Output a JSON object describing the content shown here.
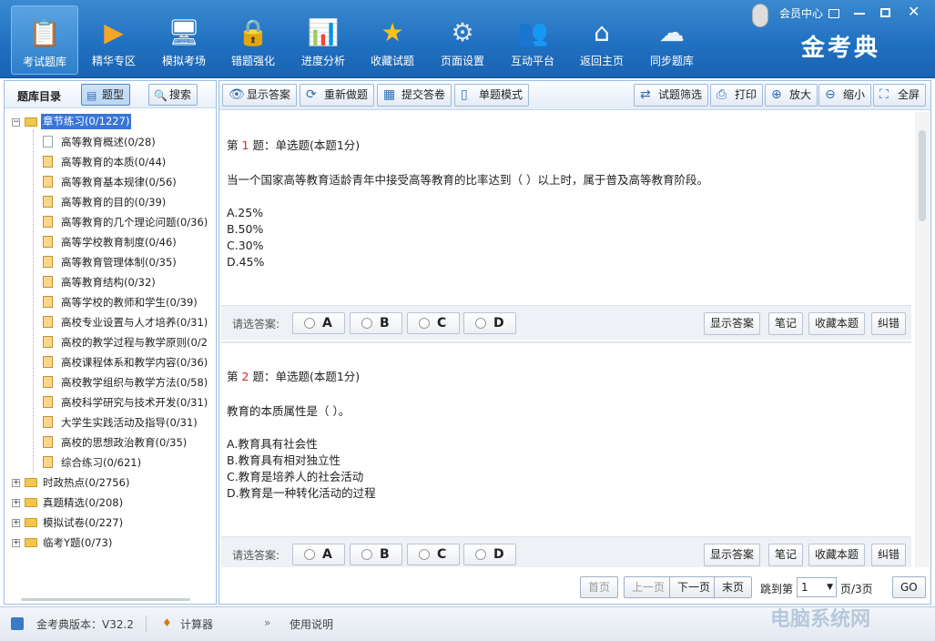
{
  "app": {
    "title": "金考典"
  },
  "toolbar_top": [
    {
      "label": "考试题库",
      "icon": "document-stack-icon",
      "glyph": "📋"
    },
    {
      "label": "精华专区",
      "icon": "play-disc-icon",
      "glyph": "▶"
    },
    {
      "label": "模拟考场",
      "icon": "monitor-icon",
      "glyph": "🖥"
    },
    {
      "label": "错题强化",
      "icon": "clipboard-lock-icon",
      "glyph": "🔒"
    },
    {
      "label": "进度分析",
      "icon": "bar-chart-icon",
      "glyph": "📊"
    },
    {
      "label": "收藏试题",
      "icon": "star-icon",
      "glyph": "★"
    },
    {
      "label": "页面设置",
      "icon": "gear-icon",
      "glyph": "⚙"
    },
    {
      "label": "互动平台",
      "icon": "users-icon",
      "glyph": "👥"
    },
    {
      "label": "返回主页",
      "icon": "home-icon",
      "glyph": "⌂"
    },
    {
      "label": "同步题库",
      "icon": "cloud-sync-icon",
      "glyph": "☁"
    }
  ],
  "window": {
    "member": "会员中心"
  },
  "left": {
    "title": "题库目录",
    "btn_type": "题型",
    "btn_search": "搜索",
    "tree_root": "章节练习(0/1227)",
    "chapters": [
      {
        "label": "高等教育概述(0/28)",
        "kind": "page"
      },
      {
        "label": "高等教育的本质(0/44)",
        "kind": "lock"
      },
      {
        "label": "高等教育基本规律(0/56)",
        "kind": "lock"
      },
      {
        "label": "高等教育的目的(0/39)",
        "kind": "lock"
      },
      {
        "label": "高等教育的几个理论问题(0/36)",
        "kind": "lock"
      },
      {
        "label": "高等学校教育制度(0/46)",
        "kind": "lock"
      },
      {
        "label": "高等教育管理体制(0/35)",
        "kind": "lock"
      },
      {
        "label": "高等教育结构(0/32)",
        "kind": "lock"
      },
      {
        "label": "高等学校的教师和学生(0/39)",
        "kind": "lock"
      },
      {
        "label": "高校专业设置与人才培养(0/31)",
        "kind": "lock"
      },
      {
        "label": "高校的教学过程与教学原则(0/2",
        "kind": "lock"
      },
      {
        "label": "高校课程体系和教学内容(0/36)",
        "kind": "lock"
      },
      {
        "label": "高校教学组织与教学方法(0/58)",
        "kind": "lock"
      },
      {
        "label": "高校科学研究与技术开发(0/31)",
        "kind": "lock"
      },
      {
        "label": "大学生实践活动及指导(0/31)",
        "kind": "lock"
      },
      {
        "label": "高校的思想政治教育(0/35)",
        "kind": "lock"
      },
      {
        "label": "综合练习(0/621)",
        "kind": "lock"
      }
    ],
    "others": [
      "时政热点(0/2756)",
      "真题精选(0/208)",
      "模拟试卷(0/227)",
      "临考Y题(0/73)"
    ]
  },
  "tools": {
    "show_answer": "显示答案",
    "redo": "重新做题",
    "submit": "提交答卷",
    "single_mode": "单题模式",
    "filter": "试题筛选",
    "print": "打印",
    "zoom_in": "放大",
    "zoom_out": "缩小",
    "fullscreen": "全屏"
  },
  "questions": [
    {
      "prefix": "第",
      "num": "1",
      "suffix": "题：单选题(本题1分)",
      "stem": "当一个国家高等教育适龄青年中接受高等教育的比率达到（ ）以上时，属于普及高等教育阶段。",
      "options": [
        "A.25%",
        "B.50%",
        "C.30%",
        "D.45%"
      ]
    },
    {
      "prefix": "第",
      "num": "2",
      "suffix": "题：单选题(本题1分)",
      "stem": "教育的本质属性是（ ）。",
      "options": [
        "A.教育具有社会性",
        "B.教育具有相对独立性",
        "C.教育是培养人的社会活动",
        "D.教育是一种转化活动的过程"
      ]
    }
  ],
  "answer_bar": {
    "label": "请选答案:",
    "choices": [
      "A",
      "B",
      "C",
      "D"
    ],
    "show": "显示答案",
    "note": "笔记",
    "fav": "收藏本题",
    "fix": "纠错"
  },
  "pager": {
    "first": "首页",
    "prev": "上一页",
    "next": "下一页",
    "last": "末页",
    "jump": "跳到第",
    "page": "1",
    "total": "页/3页",
    "go": "GO"
  },
  "status": {
    "version": "金考典版本：V32.2",
    "calc": "计算器",
    "help": "使用说明"
  },
  "watermark": "电脑系统网"
}
